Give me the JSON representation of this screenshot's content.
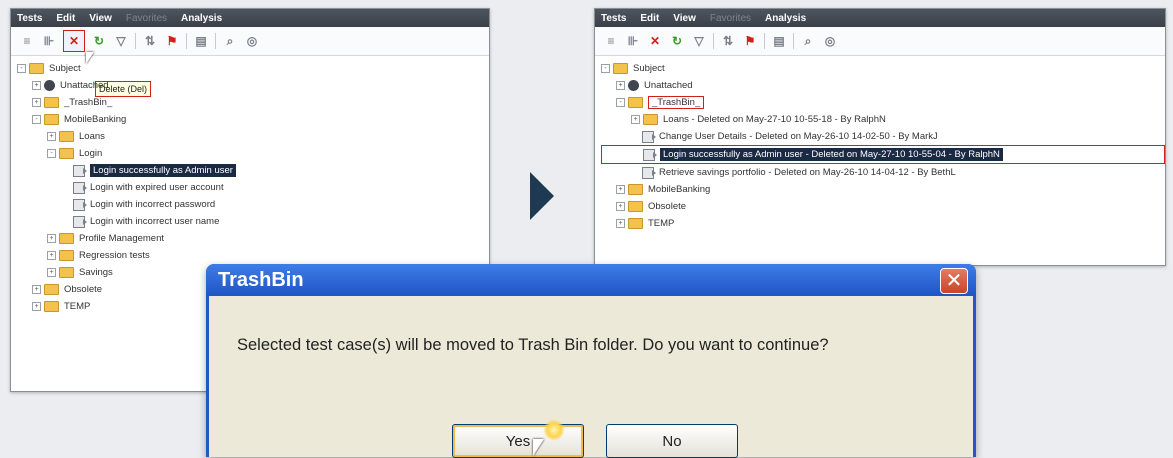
{
  "menu": {
    "items": [
      "Tests",
      "Edit",
      "View",
      "Favorites",
      "Analysis"
    ]
  },
  "tooltip": "Delete (Del)",
  "left_tree": [
    {
      "label": "Subject",
      "kind": "folder",
      "indent": 0,
      "pm": "-"
    },
    {
      "label": "Unattached",
      "kind": "unattached",
      "indent": 1,
      "pm": "+"
    },
    {
      "label": "_TrashBin_",
      "kind": "folder",
      "indent": 1,
      "pm": "+"
    },
    {
      "label": "MobileBanking",
      "kind": "folder",
      "indent": 1,
      "pm": "-"
    },
    {
      "label": "Loans",
      "kind": "folder",
      "indent": 2,
      "pm": "+"
    },
    {
      "label": "Login",
      "kind": "folder",
      "indent": 2,
      "pm": "-"
    },
    {
      "label": "Login successfully as Admin user",
      "kind": "test",
      "indent": 3,
      "selected": true
    },
    {
      "label": "Login with expired user account",
      "kind": "test",
      "indent": 3
    },
    {
      "label": "Login with incorrect password",
      "kind": "test",
      "indent": 3
    },
    {
      "label": "Login with incorrect user name",
      "kind": "test",
      "indent": 3
    },
    {
      "label": "Profile Management",
      "kind": "folder",
      "indent": 2,
      "pm": "+"
    },
    {
      "label": "Regression tests",
      "kind": "folder",
      "indent": 2,
      "pm": "+"
    },
    {
      "label": "Savings",
      "kind": "folder",
      "indent": 2,
      "pm": "+"
    },
    {
      "label": "Obsolete",
      "kind": "folder",
      "indent": 1,
      "pm": "+"
    },
    {
      "label": "TEMP",
      "kind": "folder",
      "indent": 1,
      "pm": "+"
    }
  ],
  "right_tree": [
    {
      "label": "Subject",
      "kind": "folder",
      "indent": 0,
      "pm": "-"
    },
    {
      "label": "Unattached",
      "kind": "unattached",
      "indent": 1,
      "pm": "+"
    },
    {
      "label": "_TrashBin_",
      "kind": "folder",
      "indent": 1,
      "pm": "-",
      "boxed": true
    },
    {
      "label": "Loans - Deleted on May-27-10 10-55-18 - By RalphN",
      "kind": "folder",
      "indent": 2,
      "pm": "+"
    },
    {
      "label": "Change User Details - Deleted on May-26-10 14-02-50 - By MarkJ",
      "kind": "test",
      "indent": 2
    },
    {
      "label": "Login successfully as Admin user - Deleted on May-27-10 10-55-04 - By RalphN",
      "kind": "test",
      "indent": 2,
      "selected": true,
      "boxed": true
    },
    {
      "label": "Retrieve savings portfolio - Deleted on May-26-10 14-04-12 - By BethL",
      "kind": "test",
      "indent": 2
    },
    {
      "label": "MobileBanking",
      "kind": "folder",
      "indent": 1,
      "pm": "+"
    },
    {
      "label": "Obsolete",
      "kind": "folder",
      "indent": 1,
      "pm": "+"
    },
    {
      "label": "TEMP",
      "kind": "folder",
      "indent": 1,
      "pm": "+"
    }
  ],
  "dialog": {
    "title": "TrashBin",
    "close": "✕",
    "message": "Selected test case(s) will be moved to Trash Bin folder. Do you want to continue?",
    "yes_label": "Yes",
    "no_label": "No"
  },
  "colors": {
    "accent_red": "#d0201a",
    "selection": "#1b2a43",
    "dialog_blue": "#2257c5",
    "arrow": "#1d3a52"
  },
  "icons": [
    "grid-icon",
    "tree-icon",
    "delete-icon",
    "refresh-icon",
    "filter-icon",
    "sort-icon",
    "flag-icon",
    "view-icon",
    "find-icon",
    "zoom-icon"
  ]
}
